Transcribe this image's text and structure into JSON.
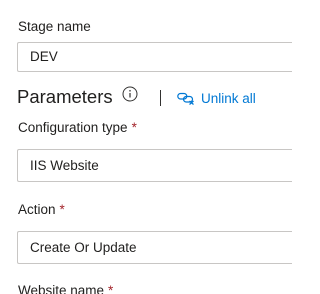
{
  "stage": {
    "label": "Stage name",
    "value": "DEV"
  },
  "parameters": {
    "title": "Parameters",
    "info_icon": "info-icon",
    "unlink_icon": "unlink-icon",
    "unlink_label": "Unlink all"
  },
  "configuration_type": {
    "label": "Configuration type",
    "required_mark": "*",
    "value": "IIS Website"
  },
  "action": {
    "label": "Action",
    "required_mark": "*",
    "value": "Create Or Update"
  },
  "website_name": {
    "label": "Website name",
    "required_mark": "*"
  },
  "colors": {
    "text": "#201f1e",
    "border": "#c8c6c4",
    "link": "#0078d4",
    "required": "#a4262c"
  }
}
